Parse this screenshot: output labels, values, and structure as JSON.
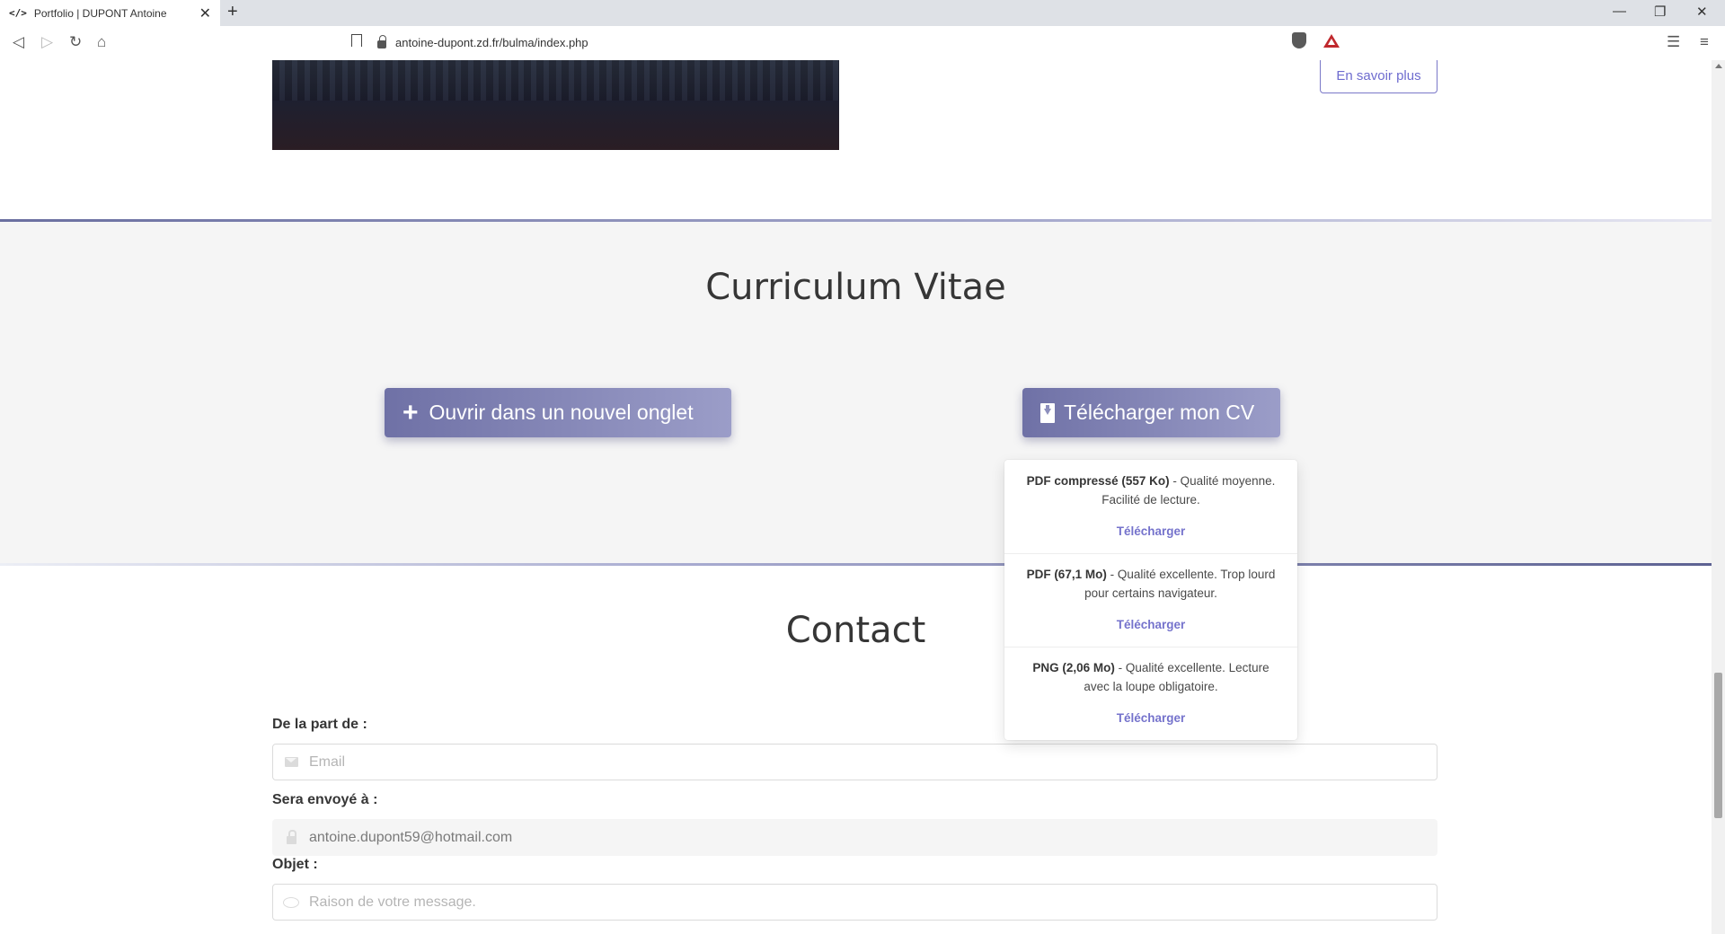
{
  "browser": {
    "tab_title": "Portfolio | DUPONT Antoine",
    "tab_icon": "</>",
    "url": "antoine-dupont.zd.fr/bulma/index.php"
  },
  "project": {
    "more_label": "En savoir plus"
  },
  "cv": {
    "title": "Curriculum Vitae",
    "open_label": "Ouvrir dans un nouvel onglet",
    "download_label": "Télécharger mon CV",
    "options": [
      {
        "name": "PDF compressé (557 Ko)",
        "desc": " - Qualité moyenne. Facilité de lecture.",
        "link": "Télécharger"
      },
      {
        "name": "PDF (67,1 Mo)",
        "desc": " - Qualité excellente. Trop lourd pour certains navigateur.",
        "link": "Télécharger"
      },
      {
        "name": "PNG (2,06 Mo)",
        "desc": " - Qualité excellente. Lecture avec la loupe obligatoire.",
        "link": "Télécharger"
      }
    ]
  },
  "contact": {
    "title": "Contact",
    "from_label": "De la part de :",
    "from_placeholder": "Email",
    "to_label": "Sera envoyé à :",
    "to_value": "antoine.dupont59@hotmail.com",
    "subject_label": "Objet :",
    "subject_placeholder": "Raison de votre message."
  },
  "colors": {
    "accent": "#7573cc",
    "button_gradient_start": "#6f71a6",
    "button_gradient_end": "#9b9dc8"
  }
}
